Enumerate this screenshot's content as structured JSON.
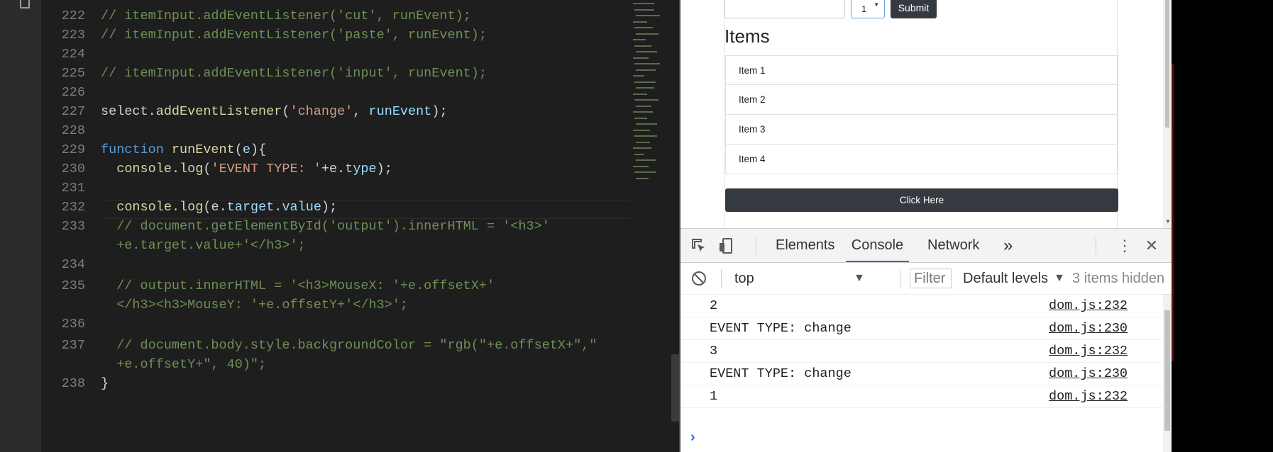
{
  "editor": {
    "lines": [
      {
        "num": "222",
        "segments": [
          {
            "c": "cm",
            "t": "// itemInput.addEventListener('cut', runEvent);"
          }
        ]
      },
      {
        "num": "223",
        "segments": [
          {
            "c": "cm",
            "t": "// itemInput.addEventListener('paste', runEvent);"
          }
        ]
      },
      {
        "num": "224",
        "segments": []
      },
      {
        "num": "225",
        "segments": [
          {
            "c": "cm",
            "t": "// itemInput.addEventListener('input', runEvent);"
          }
        ]
      },
      {
        "num": "226",
        "segments": []
      },
      {
        "num": "227",
        "segments": [
          {
            "c": "pl",
            "t": "select."
          },
          {
            "c": "fn",
            "t": "addEventListener"
          },
          {
            "c": "pl",
            "t": "("
          },
          {
            "c": "str",
            "t": "'change'"
          },
          {
            "c": "pl",
            "t": ", "
          },
          {
            "c": "var",
            "t": "runEvent"
          },
          {
            "c": "pl",
            "t": ");"
          }
        ]
      },
      {
        "num": "228",
        "segments": []
      },
      {
        "num": "229",
        "segments": [
          {
            "c": "kw",
            "t": "function "
          },
          {
            "c": "fn",
            "t": "runEvent"
          },
          {
            "c": "pl",
            "t": "("
          },
          {
            "c": "var",
            "t": "e"
          },
          {
            "c": "pl",
            "t": "){"
          }
        ]
      },
      {
        "num": "230",
        "segments": [
          {
            "c": "pl",
            "t": "  "
          },
          {
            "c": "fn",
            "t": "console"
          },
          {
            "c": "pl",
            "t": "."
          },
          {
            "c": "fn",
            "t": "log"
          },
          {
            "c": "pl",
            "t": "("
          },
          {
            "c": "str",
            "t": "'EVENT TYPE: '"
          },
          {
            "c": "pl",
            "t": "+e."
          },
          {
            "c": "var",
            "t": "type"
          },
          {
            "c": "pl",
            "t": ");"
          }
        ]
      },
      {
        "num": "231",
        "segments": []
      },
      {
        "num": "232",
        "segments": [
          {
            "c": "pl",
            "t": "  "
          },
          {
            "c": "fn",
            "t": "console"
          },
          {
            "c": "pl",
            "t": "."
          },
          {
            "c": "fn",
            "t": "log"
          },
          {
            "c": "pl",
            "t": "(e."
          },
          {
            "c": "var",
            "t": "target"
          },
          {
            "c": "pl",
            "t": "."
          },
          {
            "c": "var",
            "t": "value"
          },
          {
            "c": "pl",
            "t": ");"
          }
        ]
      },
      {
        "num": "233",
        "segments": [
          {
            "c": "cm",
            "t": "  // document.getElementById('output').innerHTML = '<h3>'"
          }
        ]
      },
      {
        "num": "",
        "segments": [
          {
            "c": "cm",
            "t": "  +e.target.value+'</h3>';"
          }
        ]
      },
      {
        "num": "234",
        "segments": []
      },
      {
        "num": "235",
        "segments": [
          {
            "c": "cm",
            "t": "  // output.innerHTML = '<h3>MouseX: '+e.offsetX+'"
          }
        ]
      },
      {
        "num": "",
        "segments": [
          {
            "c": "cm",
            "t": "  </h3><h3>MouseY: '+e.offsetY+'</h3>';"
          }
        ]
      },
      {
        "num": "236",
        "segments": []
      },
      {
        "num": "237",
        "segments": [
          {
            "c": "cm",
            "t": "  // document.body.style.backgroundColor = \"rgb(\"+e.offsetX+\",\""
          }
        ]
      },
      {
        "num": "",
        "segments": [
          {
            "c": "cm",
            "t": "  +e.offsetY+\", 40)\";"
          }
        ]
      },
      {
        "num": "238",
        "segments": [
          {
            "c": "pl",
            "t": "}"
          }
        ]
      }
    ]
  },
  "page": {
    "select_value": "1",
    "submit_label": "Submit",
    "items_heading": "Items",
    "items": [
      "Item 1",
      "Item 2",
      "Item 3",
      "Item 4"
    ],
    "click_button_label": "Click Here"
  },
  "devtools": {
    "tabs": {
      "elements": "Elements",
      "console": "Console",
      "network": "Network",
      "more": "»"
    },
    "context": "top",
    "filter_placeholder": "Filter",
    "levels": "Default levels",
    "hidden_count": "3 items hidden",
    "messages": [
      {
        "value": "2",
        "source": "dom.js:232"
      },
      {
        "value": "EVENT TYPE: change",
        "source": "dom.js:230"
      },
      {
        "value": "3",
        "source": "dom.js:232"
      },
      {
        "value": "EVENT TYPE: change",
        "source": "dom.js:230"
      },
      {
        "value": "1",
        "source": "dom.js:232"
      }
    ],
    "prompt_symbol": "›"
  }
}
